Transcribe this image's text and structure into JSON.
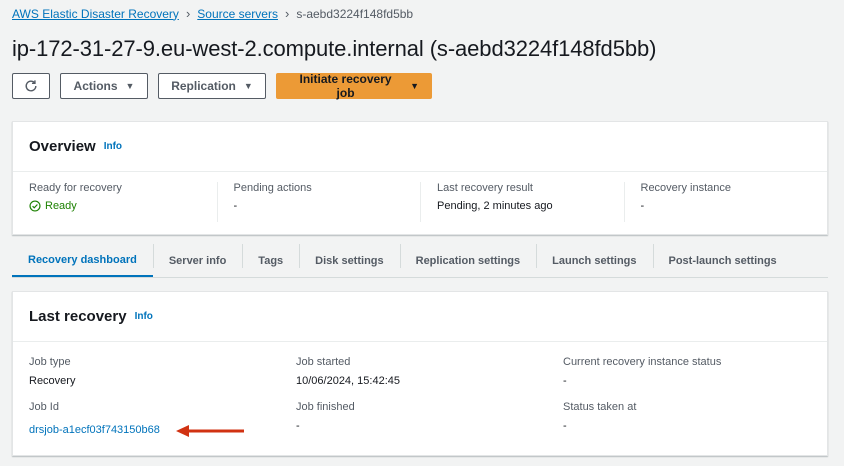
{
  "breadcrumb": {
    "items": [
      "AWS Elastic Disaster Recovery",
      "Source servers"
    ],
    "current": "s-aebd3224f148fd5bb"
  },
  "page_title": "ip-172-31-27-9.eu-west-2.compute.internal (s-aebd3224f148fd5bb)",
  "toolbar": {
    "refresh_icon": "refresh-icon",
    "actions_label": "Actions",
    "replication_label": "Replication",
    "initiate_label": "Initiate recovery job"
  },
  "overview": {
    "title": "Overview",
    "info": "Info",
    "ready_for_recovery_label": "Ready for recovery",
    "ready_for_recovery_value": "Ready",
    "pending_actions_label": "Pending actions",
    "pending_actions_value": "-",
    "last_result_label": "Last recovery result",
    "last_result_value": "Pending, 2 minutes ago",
    "recovery_instance_label": "Recovery instance",
    "recovery_instance_value": "-"
  },
  "tabs": [
    "Recovery dashboard",
    "Server info",
    "Tags",
    "Disk settings",
    "Replication settings",
    "Launch settings",
    "Post-launch settings"
  ],
  "active_tab": "Recovery dashboard",
  "last_recovery": {
    "title": "Last recovery",
    "info": "Info",
    "job_type_label": "Job type",
    "job_type_value": "Recovery",
    "job_started_label": "Job started",
    "job_started_value": "10/06/2024, 15:42:45",
    "current_status_label": "Current recovery instance status",
    "current_status_value": "-",
    "job_id_label": "Job Id",
    "job_id_value": "drsjob-a1ecf03f743150b68",
    "job_finished_label": "Job finished",
    "job_finished_value": "-",
    "status_taken_label": "Status taken at",
    "status_taken_value": "-"
  },
  "colors": {
    "accent": "#0073bb",
    "primary_button": "#ec9a36",
    "success": "#1d8102",
    "annotation_arrow": "#d13212"
  }
}
